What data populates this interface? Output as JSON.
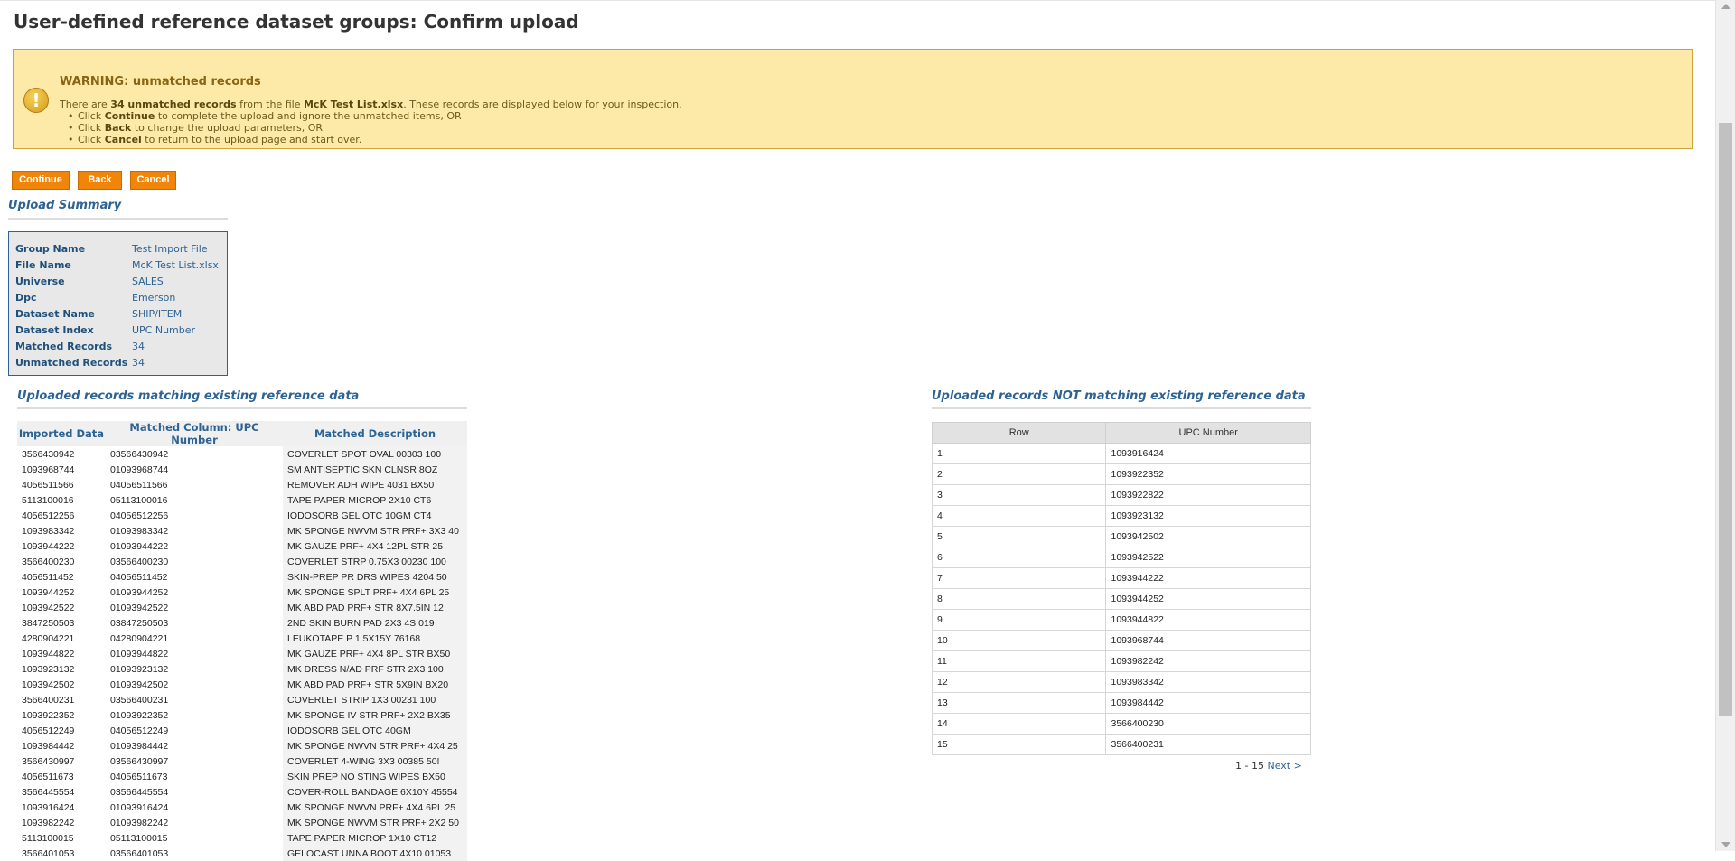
{
  "page": {
    "title": "User-defined reference dataset groups: Confirm upload"
  },
  "warning": {
    "title": "WARNING: unmatched records",
    "line_pre": "There are ",
    "count_text": "34 unmatched records",
    "line_mid": " from the file ",
    "file": "McK Test List.xlsx",
    "line_post": ". These records are displayed below for your inspection.",
    "bullets": [
      {
        "pre": "Click ",
        "bold": "Continue",
        "post": " to complete the upload and ignore the unmatched items, OR"
      },
      {
        "pre": "Click ",
        "bold": "Back",
        "post": " to change the upload parameters, OR"
      },
      {
        "pre": "Click ",
        "bold": "Cancel",
        "post": " to return to the upload page and start over."
      }
    ]
  },
  "buttons": {
    "continue": "Continue",
    "back": "Back",
    "cancel": "Cancel"
  },
  "summary": {
    "title": "Upload Summary",
    "rows": [
      {
        "label": "Group Name",
        "value": "Test Import File"
      },
      {
        "label": "File Name",
        "value": "McK Test List.xlsx"
      },
      {
        "label": "Universe",
        "value": "SALES"
      },
      {
        "label": "Dpc",
        "value": "Emerson"
      },
      {
        "label": "Dataset Name",
        "value": "SHIP/ITEM"
      },
      {
        "label": "Dataset Index",
        "value": "UPC Number"
      },
      {
        "label": "Matched Records",
        "value": "34"
      },
      {
        "label": "Unmatched Records",
        "value": "34"
      }
    ]
  },
  "matching": {
    "title": "Uploaded records matching existing reference data",
    "headers": [
      "Imported Data",
      "Matched Column: UPC Number",
      "Matched Description"
    ],
    "rows": [
      [
        "3566430942",
        "03566430942",
        "COVERLET SPOT OVAL 00303 100"
      ],
      [
        "1093968744",
        "01093968744",
        "SM ANTISEPTIC SKN CLNSR 8OZ"
      ],
      [
        "4056511566",
        "04056511566",
        "REMOVER ADH WIPE 4031 BX50"
      ],
      [
        "5113100016",
        "05113100016",
        "TAPE PAPER MICROP 2X10 CT6"
      ],
      [
        "4056512256",
        "04056512256",
        "IODOSORB GEL OTC 10GM CT4"
      ],
      [
        "1093983342",
        "01093983342",
        "MK SPONGE NWVM STR PRF+ 3X3 40"
      ],
      [
        "1093944222",
        "01093944222",
        "MK GAUZE PRF+ 4X4 12PL STR 25"
      ],
      [
        "3566400230",
        "03566400230",
        "COVERLET STRP 0.75X3 00230 100"
      ],
      [
        "4056511452",
        "04056511452",
        "SKIN-PREP PR DRS WIPES 4204 50"
      ],
      [
        "1093944252",
        "01093944252",
        "MK SPONGE SPLT PRF+ 4X4 6PL 25"
      ],
      [
        "1093942522",
        "01093942522",
        "MK ABD PAD PRF+ STR 8X7.5IN 12"
      ],
      [
        "3847250503",
        "03847250503",
        "2ND SKIN BURN PAD 2X3 4S 019"
      ],
      [
        "4280904221",
        "04280904221",
        "LEUKOTAPE P 1.5X15Y 76168"
      ],
      [
        "1093944822",
        "01093944822",
        "MK GAUZE PRF+ 4X4 8PL STR BX50"
      ],
      [
        "1093923132",
        "01093923132",
        "MK DRESS N/AD PRF STR 2X3 100"
      ],
      [
        "1093942502",
        "01093942502",
        "MK ABD PAD PRF+ STR 5X9IN BX20"
      ],
      [
        "3566400231",
        "03566400231",
        "COVERLET STRIP 1X3 00231 100"
      ],
      [
        "1093922352",
        "01093922352",
        "MK SPONGE IV STR PRF+ 2X2 BX35"
      ],
      [
        "4056512249",
        "04056512249",
        "IODOSORB GEL OTC 40GM"
      ],
      [
        "1093984442",
        "01093984442",
        "MK SPONGE NWVN STR PRF+ 4X4 25"
      ],
      [
        "3566430997",
        "03566430997",
        "COVERLET 4-WING 3X3 00385 50!"
      ],
      [
        "4056511673",
        "04056511673",
        "SKIN PREP NO STING WIPES BX50"
      ],
      [
        "3566445554",
        "03566445554",
        "COVER-ROLL BANDAGE 6X10Y 45554"
      ],
      [
        "1093916424",
        "01093916424",
        "MK SPONGE NWVN PRF+ 4X4 6PL 25"
      ],
      [
        "1093982242",
        "01093982242",
        "MK SPONGE NWVM STR PRF+ 2X2 50"
      ],
      [
        "5113100015",
        "05113100015",
        "TAPE PAPER MICROP 1X10 CT12"
      ],
      [
        "3566401053",
        "03566401053",
        "GELOCAST UNNA BOOT 4X10 01053"
      ]
    ]
  },
  "not_matching": {
    "title": "Uploaded records NOT matching existing reference data",
    "headers": [
      "Row",
      "UPC Number"
    ],
    "rows": [
      [
        "1",
        "1093916424"
      ],
      [
        "2",
        "1093922352"
      ],
      [
        "3",
        "1093922822"
      ],
      [
        "4",
        "1093923132"
      ],
      [
        "5",
        "1093942502"
      ],
      [
        "6",
        "1093942522"
      ],
      [
        "7",
        "1093944222"
      ],
      [
        "8",
        "1093944252"
      ],
      [
        "9",
        "1093944822"
      ],
      [
        "10",
        "1093968744"
      ],
      [
        "11",
        "1093982242"
      ],
      [
        "12",
        "1093983342"
      ],
      [
        "13",
        "1093984442"
      ],
      [
        "14",
        "3566400230"
      ],
      [
        "15",
        "3566400231"
      ]
    ],
    "pager": {
      "range": "1 - 15",
      "next": "Next >"
    }
  },
  "colors": {
    "accent_button": "#f0850a",
    "link": "#2d6394",
    "warning_bg": "#fdeaa8"
  },
  "icons": {
    "warning": "warning-exclamation-icon"
  }
}
